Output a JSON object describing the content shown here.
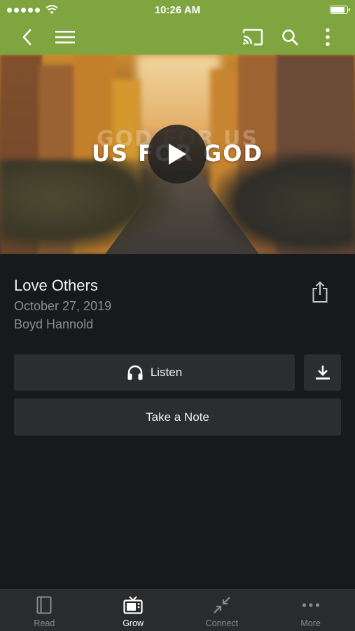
{
  "status": {
    "time": "10:26 AM",
    "battery_level": 0.95
  },
  "nav": {
    "back_icon": "chevron-left-icon",
    "menu_icon": "hamburger-icon",
    "cast_icon": "cast-icon",
    "search_icon": "search-icon",
    "more_icon": "more-vertical-icon"
  },
  "video": {
    "ghost_title": "GOD FOR US",
    "title": "US FOR GOD",
    "play_icon": "play-icon"
  },
  "sermon": {
    "title": "Love Others",
    "date": "October 27, 2019",
    "speaker": "Boyd Hannold"
  },
  "actions": {
    "listen_label": "Listen",
    "note_label": "Take a Note"
  },
  "tabs": [
    {
      "label": "Read",
      "icon": "book-icon",
      "active": false
    },
    {
      "label": "Grow",
      "icon": "tv-icon",
      "active": true
    },
    {
      "label": "Connect",
      "icon": "arrows-in-icon",
      "active": false
    },
    {
      "label": "More",
      "icon": "more-horizontal-icon",
      "active": false
    }
  ],
  "colors": {
    "accent": "#7ea540",
    "background": "#18191b",
    "button": "#2c2d2f"
  }
}
